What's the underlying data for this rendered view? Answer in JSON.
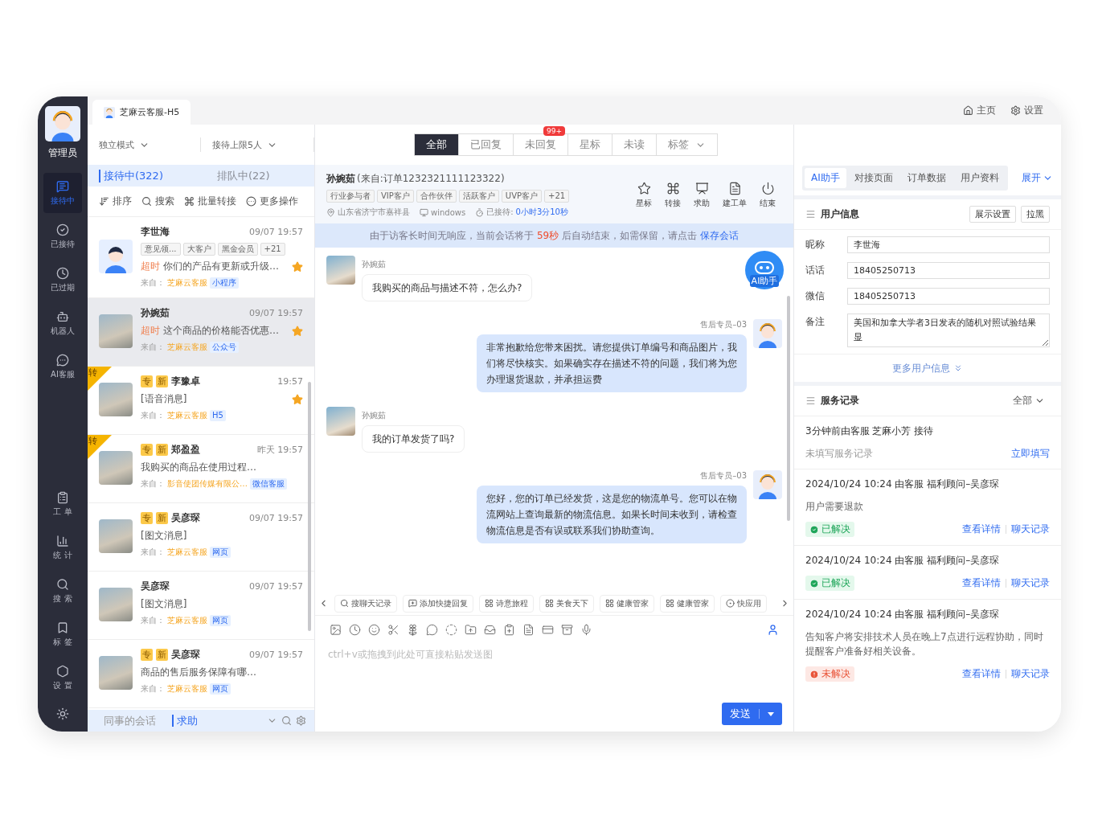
{
  "topbar": {
    "tab": "芝麻云客服-H5",
    "links": [
      "主页",
      "设置"
    ]
  },
  "sidebar": {
    "user": "管理员",
    "items": [
      {
        "label": "接待中",
        "selected": true
      },
      {
        "label": "已接待",
        "selected": false
      },
      {
        "label": "已过期",
        "selected": false
      },
      {
        "label": "机器人",
        "selected": false
      },
      {
        "label": "AI客服",
        "selected": false
      }
    ],
    "tools": [
      "工 单",
      "统 计",
      "搜 索",
      "标 签",
      "设 置"
    ]
  },
  "list": {
    "modes": [
      "独立模式",
      "接待上限5人"
    ],
    "queues": [
      {
        "label": "接待中(322)",
        "selected": true
      },
      {
        "label": "排队中(22)",
        "selected": false
      }
    ],
    "actions": [
      "排序",
      "搜索",
      "批量转接",
      "更多操作"
    ],
    "items": [
      {
        "kind": "cartoon",
        "name": "李世海",
        "time": "09/07 19:57",
        "tags": [
          "意见领...",
          "大客户",
          "黑金会员",
          "+21"
        ],
        "alert": "超时",
        "message": "你们的产品有更新或升级…",
        "source_label": "来自：",
        "source": "芝麻云客服",
        "channel": "小程序",
        "starred": true,
        "selected": false
      },
      {
        "kind": "photo",
        "name": "孙婉茹",
        "time": "09/07 19:57",
        "alert": "超时",
        "message": "这个商品的价格能否优惠…",
        "source_label": "来自：",
        "source": "芝麻云客服",
        "channel": "公众号",
        "starred": true,
        "selected": true
      },
      {
        "kind": "photo",
        "corner": "转",
        "badges": [
          "专",
          "新"
        ],
        "name": "李豫卓",
        "time": "19:57",
        "message": "[语音消息]",
        "source_label": "来自：",
        "source": "芝麻云客服",
        "channel": "H5",
        "starred": true,
        "selected": false
      },
      {
        "kind": "photo",
        "corner": "转",
        "badges": [
          "专",
          "新"
        ],
        "name": "郑盈盈",
        "time": "昨天 19:57",
        "message": "我购买的商品在使用过程…",
        "source_label": "来自：",
        "source": "影音使团传媒有限公…",
        "channel": "微信客服",
        "starred": false,
        "selected": false
      },
      {
        "kind": "photo",
        "badges": [
          "专",
          "新"
        ],
        "name": "吴彦琛",
        "time": "09/07 19:57",
        "message": "[图文消息]",
        "source_label": "来自：",
        "source": "芝麻云客服",
        "channel": "网页",
        "starred": false,
        "selected": false
      },
      {
        "kind": "photo",
        "name": "吴彦琛",
        "time": "09/07 19:57",
        "message": "[图文消息]",
        "source_label": "来自：",
        "source": "芝麻云客服",
        "channel": "网页",
        "starred": false,
        "selected": false
      },
      {
        "kind": "photo",
        "badges": [
          "专",
          "新"
        ],
        "name": "吴彦琛",
        "time": "09/07 19:57",
        "message": "商品的售后服务保障有哪…",
        "source_label": "来自：",
        "source": "芝麻云客服",
        "channel": "网页",
        "starred": false,
        "selected": false
      }
    ],
    "footer": [
      {
        "label": "同事的会话",
        "selected": false
      },
      {
        "label": "求助",
        "selected": true
      }
    ]
  },
  "chat": {
    "filters": [
      {
        "label": "全部",
        "selected": true
      },
      {
        "label": "已回复",
        "selected": false
      },
      {
        "label": "未回复",
        "selected": false,
        "badge": "99+"
      },
      {
        "label": "星标",
        "selected": false
      },
      {
        "label": "未读",
        "selected": false
      },
      {
        "label": "标签",
        "selected": false,
        "dropdown": true
      }
    ],
    "header": {
      "name": "孙婉茹",
      "origin": "(来自:订单1232321111123322)",
      "tags": [
        "行业参与者",
        "VIP客户",
        "合作伙伴",
        "活跃客户",
        "UVP客户",
        "+21"
      ],
      "location": "山东省济宁市嘉祥县",
      "device": "windows",
      "duration_label": "已接待:",
      "duration": "0小时3分10秒",
      "actions": [
        "星标",
        "转接",
        "求助",
        "建工单",
        "结束"
      ]
    },
    "notice": {
      "text": "由于访客长时间无响应，当前会话将于 ",
      "countdown": "59秒",
      "after": " 后自动结束，如需保留，请点击 ",
      "link": "保存会话"
    },
    "messages": [
      {
        "kind": "customer",
        "sender": "孙婉茹",
        "text": "我购买的商品与描述不符，怎么办?"
      },
      {
        "kind": "agent",
        "sender": "售后专员–03",
        "text": "非常抱歉给您带来困扰。请您提供订单编号和商品图片，我们将尽快核实。如果确实存在描述不符的问题，我们将为您办理退货退款，并承担运费"
      },
      {
        "kind": "customer",
        "sender": "孙婉茹",
        "text": "我的订单发货了吗?"
      },
      {
        "kind": "agent",
        "sender": "售后专员–03",
        "text": "您好，您的订单已经发货，这是您的物流单号。您可以在物流网站上查询最新的物流信息。如果长时间未收到，请检查物流信息是否有误或联系我们协助查询。"
      }
    ],
    "ai_button": "AI助手",
    "chips": [
      {
        "kind": "search",
        "label": "搜聊天记录"
      },
      {
        "kind": "add",
        "label": "添加快捷回复"
      },
      {
        "kind": "app",
        "label": "诗意旅程"
      },
      {
        "kind": "app",
        "label": "美食天下"
      },
      {
        "kind": "app",
        "label": "健康管家"
      },
      {
        "kind": "app",
        "label": "健康管家"
      },
      {
        "kind": "quick",
        "label": "快应用"
      }
    ],
    "input": {
      "placeholder": "ctrl+v或拖拽到此处可直接粘贴发送图"
    },
    "send": "发送"
  },
  "panel": {
    "tabs": [
      {
        "label": "AI助手",
        "selected": true
      },
      {
        "label": "对接页面",
        "selected": false
      },
      {
        "label": "订单数据",
        "selected": false
      },
      {
        "label": "用户资料",
        "selected": false
      }
    ],
    "expand": "展开",
    "user_info": {
      "title": "用户信息",
      "buttons": [
        "展示设置",
        "拉黑"
      ],
      "fields": [
        {
          "label": "昵称",
          "value": "李世海"
        },
        {
          "label": "话话",
          "value": "18405250713"
        },
        {
          "label": "微信",
          "value": "18405250713"
        }
      ],
      "note": {
        "label": "备注",
        "value": "美国和加拿大学者3日发表的随机对照试验结果显"
      },
      "more": "更多用户信息"
    },
    "records": {
      "title": "服务记录",
      "filter": "全部",
      "pending": {
        "text": "3分钟前由客服 芝麻小芳 接待",
        "hint": "未填写服务记录",
        "action": "立即填写"
      },
      "items": [
        {
          "kind": "resolved",
          "header": "2024/10/24 10:24 由客服 福利顾问–吴彦琛",
          "note": "用户需要退款",
          "status_label": "已解决",
          "links": [
            "查看详情",
            "聊天记录"
          ]
        },
        {
          "kind": "resolved",
          "header": "2024/10/24 10:24 由客服 福利顾问–吴彦琛",
          "status_label": "已解决",
          "links": [
            "查看详情",
            "聊天记录"
          ]
        },
        {
          "kind": "unresolved",
          "header": "2024/10/24 10:24 由客服 福利顾问–吴彦琛",
          "note": "告知客户将安排技术人员在晚上7点进行远程协助，同时提醒客户准备好相关设备。",
          "status_label": "未解决",
          "links": [
            "查看详情",
            "聊天记录"
          ]
        }
      ]
    }
  }
}
